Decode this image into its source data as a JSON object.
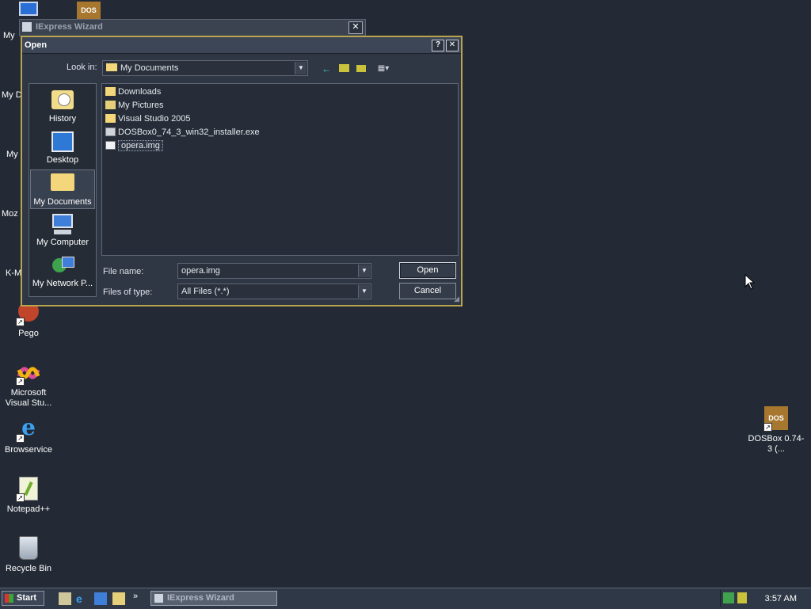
{
  "desktop": {
    "icons": [
      {
        "label": "Pego"
      },
      {
        "label": "Microsoft Visual Stu..."
      },
      {
        "label": "Browservice"
      },
      {
        "label": "Notepad++"
      },
      {
        "label": "Recycle Bin"
      },
      {
        "label": "DOSBox 0.74-3 (..."
      }
    ],
    "partial_labels": [
      "My",
      "My D",
      "My",
      "Moz",
      "K-M"
    ]
  },
  "background_window": {
    "title": "IExpress Wizard",
    "close": "✕"
  },
  "dialog": {
    "title": "Open",
    "help": "?",
    "close": "✕",
    "look_in_label": "Look in:",
    "look_in_value": "My Documents",
    "places": [
      "History",
      "Desktop",
      "My Documents",
      "My Computer",
      "My Network P..."
    ],
    "files": [
      {
        "name": "Downloads",
        "type": "folder"
      },
      {
        "name": "My Pictures",
        "type": "folder-pictures"
      },
      {
        "name": "Visual Studio 2005",
        "type": "folder"
      },
      {
        "name": "DOSBox0_74_3_win32_installer.exe",
        "type": "exe"
      },
      {
        "name": "opera.img",
        "type": "img",
        "selected": true
      }
    ],
    "file_name_label": "File name:",
    "file_name_value": "opera.img",
    "files_of_type_label": "Files of type:",
    "files_of_type_value": "All Files (*.*)",
    "open_button": "Open",
    "cancel_button": "Cancel"
  },
  "taskbar": {
    "start_label": "Start",
    "more": "»",
    "task_label": "IExpress Wizard",
    "clock": "3:57 AM"
  }
}
